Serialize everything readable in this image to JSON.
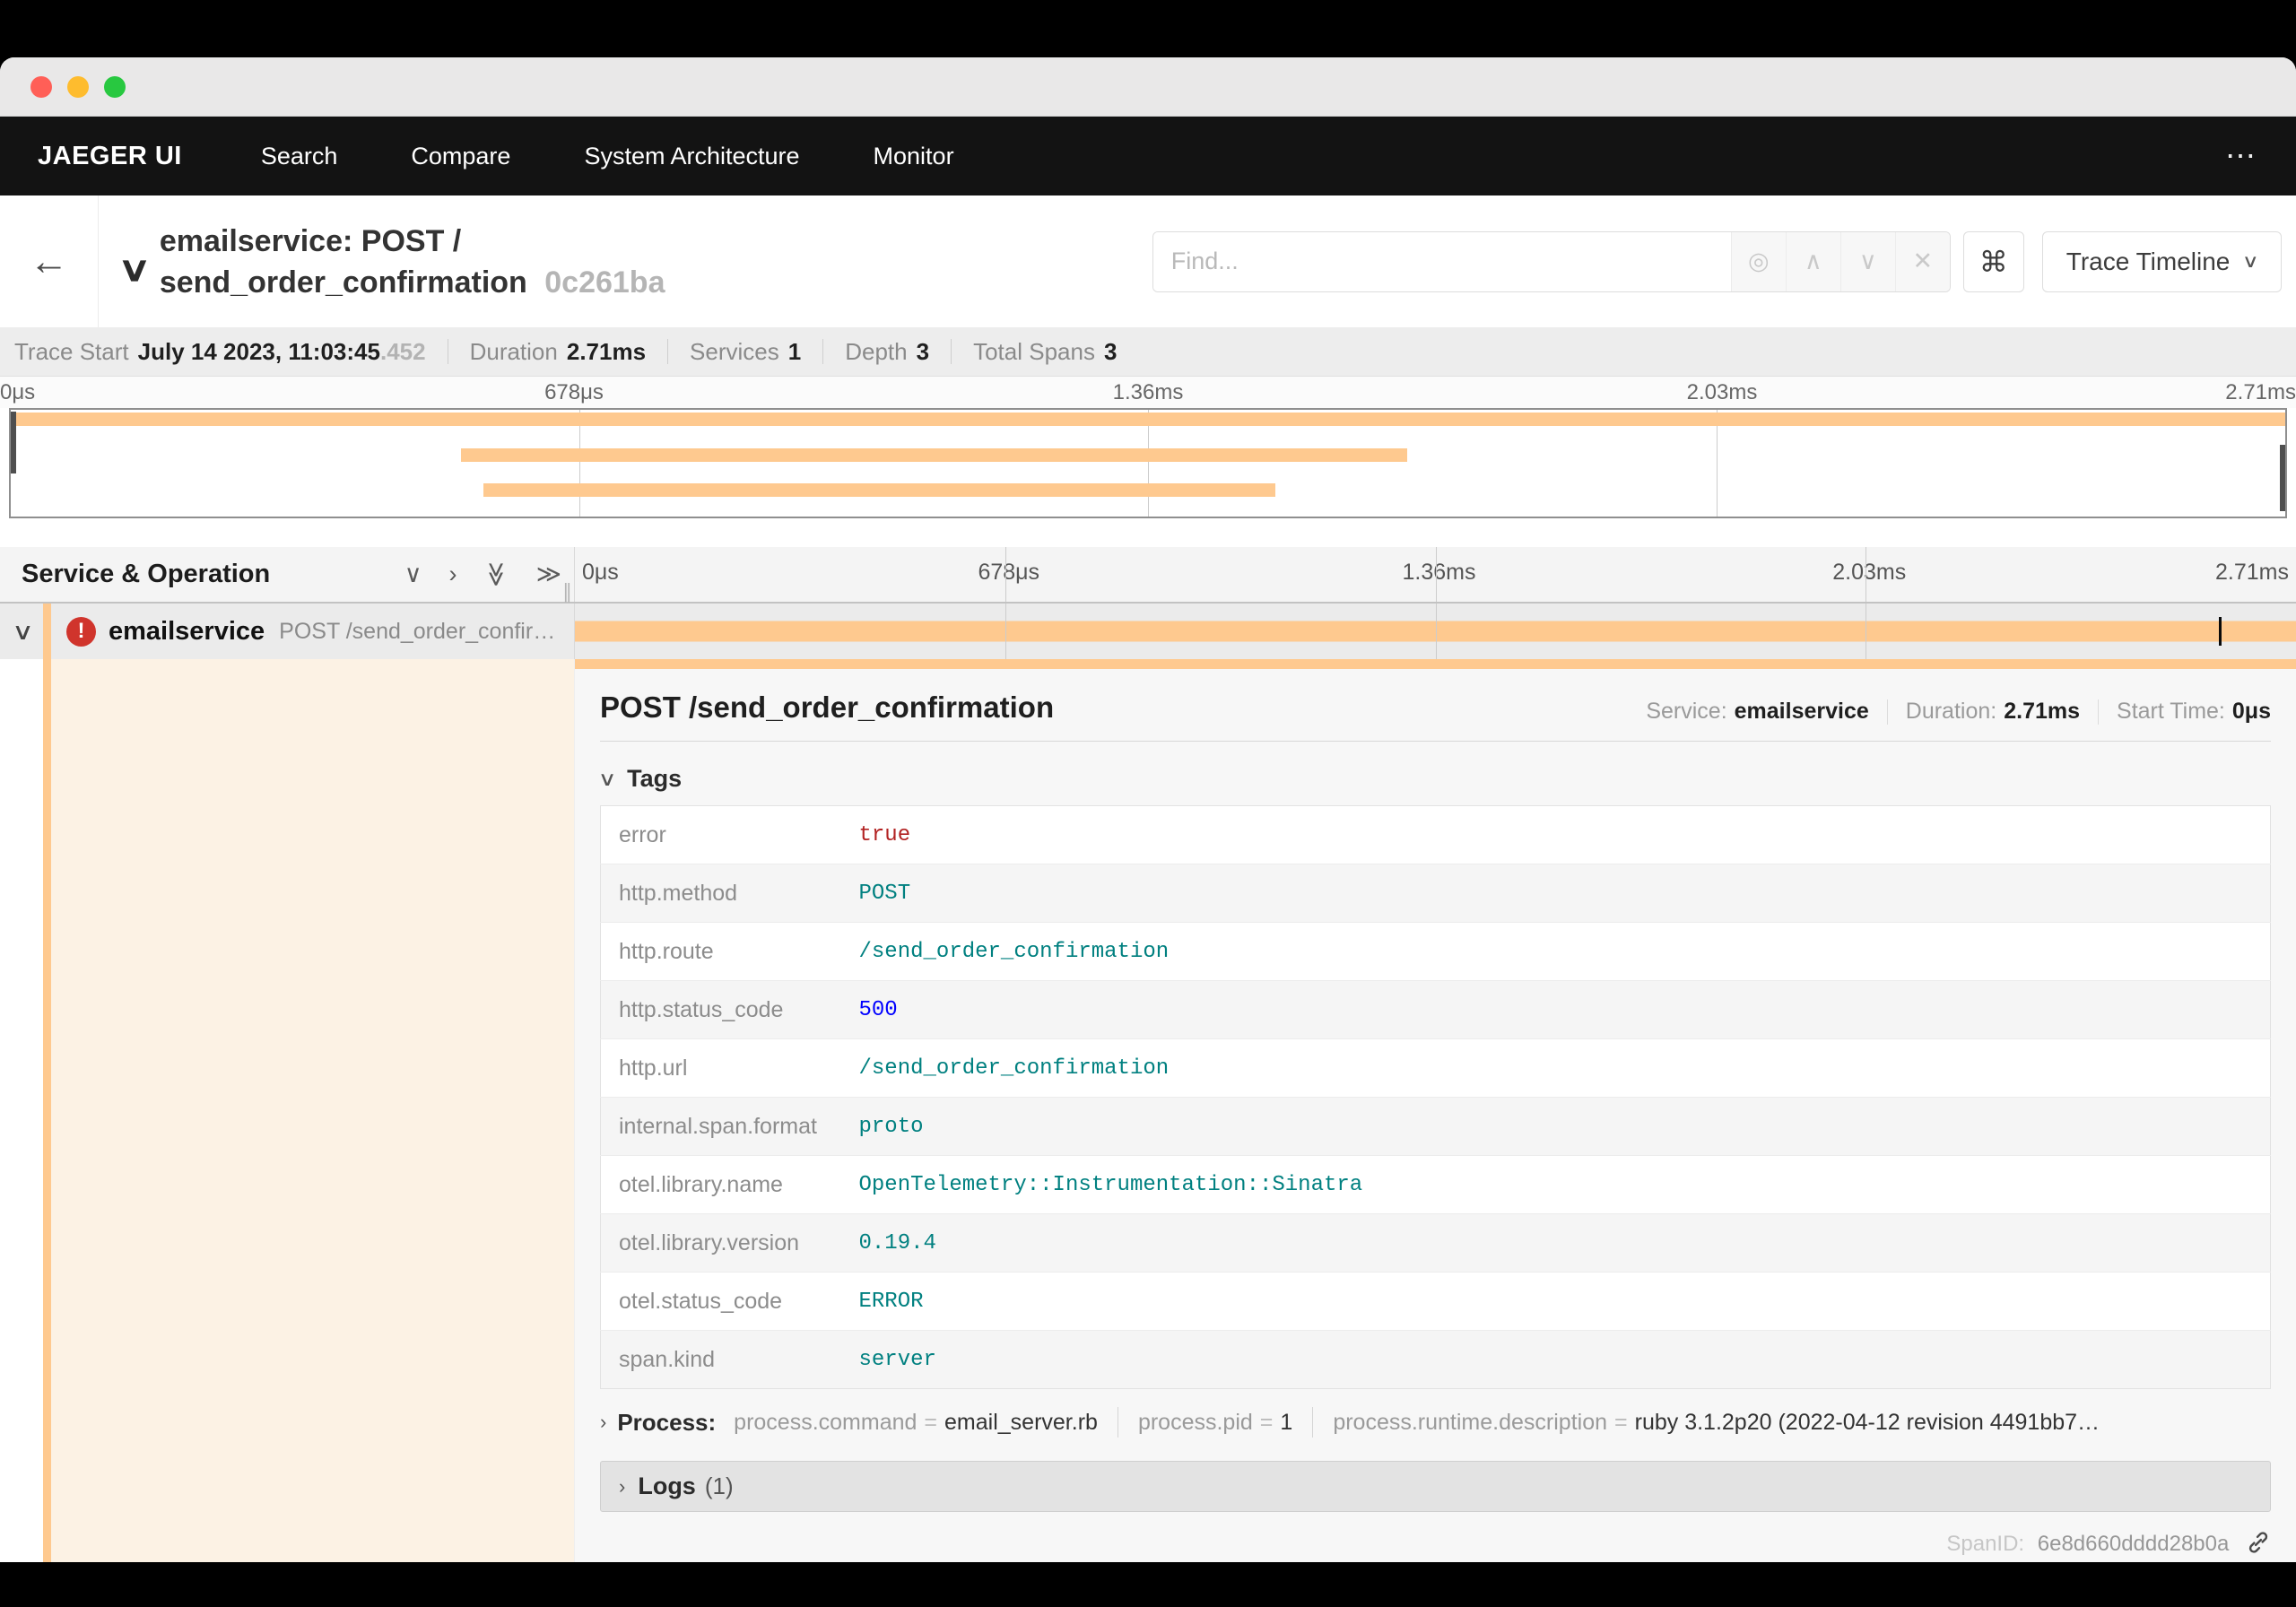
{
  "colors": {
    "accent_orange": "#FEC98F",
    "row_cream": "#FCF2E4",
    "error_red": "#D0342C",
    "value_string": "teal",
    "value_number": "blue",
    "value_bool": "firebrick"
  },
  "titlebar": {
    "lights": [
      "#ff5f57",
      "#febc2e",
      "#28c840"
    ]
  },
  "nav": {
    "brand": "JAEGER UI",
    "items": [
      "Search",
      "Compare",
      "System Architecture",
      "Monitor"
    ],
    "overflow_icon": "⋯"
  },
  "trace_header": {
    "back_icon": "←",
    "collapse_icon": "∨",
    "title_line1": "emailservice: POST /",
    "title_line2": "send_order_confirmation",
    "trace_id": "0c261ba",
    "find": {
      "placeholder": "Find...",
      "target_icon": "◎",
      "prev_icon": "∧",
      "next_icon": "∨",
      "clear_icon": "✕"
    },
    "shortcut_icon": "⌘",
    "view_dropdown": {
      "label": "Trace Timeline",
      "chevron_icon": "∨"
    }
  },
  "summary": {
    "items": [
      {
        "label": "Trace Start",
        "value": "July 14 2023, 11:03:45",
        "muted": ".452"
      },
      {
        "label": "Duration",
        "value": "2.71ms"
      },
      {
        "label": "Services",
        "value": "1"
      },
      {
        "label": "Depth",
        "value": "3"
      },
      {
        "label": "Total Spans",
        "value": "3"
      }
    ]
  },
  "ticks": [
    "0μs",
    "678μs",
    "1.36ms",
    "2.03ms",
    "2.71ms"
  ],
  "minimap": {
    "bars": [
      {
        "start": 0,
        "end": 100
      },
      {
        "start": 19.8,
        "end": 61.4
      },
      {
        "start": 20.8,
        "end": 55.6
      }
    ]
  },
  "grid_header": {
    "label": "Service & Operation",
    "collapse_one_icon": "∨",
    "expand_one_icon": "›",
    "collapse_all_icon": "≫",
    "expand_all_icon": "≫",
    "resizer_icon": "∥"
  },
  "span_row": {
    "expander_icon": "∨",
    "error_icon": "!",
    "service": "emailservice",
    "operation": "POST /send_order_confirmation",
    "bar": {
      "start": 0,
      "end": 100
    },
    "log_marker_pct": 95.5
  },
  "span_detail": {
    "title": "POST /send_order_confirmation",
    "stats": [
      {
        "label": "Service:",
        "value": "emailservice"
      },
      {
        "label": "Duration:",
        "value": "2.71ms"
      },
      {
        "label": "Start Time:",
        "value": "0μs"
      }
    ],
    "tags_section": {
      "chevron_icon": "∨",
      "label": "Tags"
    },
    "tags": [
      {
        "key": "error",
        "value": "true",
        "type": "bool"
      },
      {
        "key": "http.method",
        "value": "POST",
        "type": "string"
      },
      {
        "key": "http.route",
        "value": "/send_order_confirmation",
        "type": "string"
      },
      {
        "key": "http.status_code",
        "value": "500",
        "type": "number"
      },
      {
        "key": "http.url",
        "value": "/send_order_confirmation",
        "type": "string"
      },
      {
        "key": "internal.span.format",
        "value": "proto",
        "type": "string"
      },
      {
        "key": "otel.library.name",
        "value": "OpenTelemetry::Instrumentation::Sinatra",
        "type": "string"
      },
      {
        "key": "otel.library.version",
        "value": "0.19.4",
        "type": "string"
      },
      {
        "key": "otel.status_code",
        "value": "ERROR",
        "type": "string"
      },
      {
        "key": "span.kind",
        "value": "server",
        "type": "string"
      }
    ],
    "process_section": {
      "chevron_icon": "›",
      "label": "Process:",
      "items": [
        {
          "key": "process.command",
          "value": "email_server.rb"
        },
        {
          "key": "process.pid",
          "value": "1"
        },
        {
          "key": "process.runtime.description",
          "value": "ruby 3.1.2p20 (2022-04-12 revision 4491bb7…"
        }
      ]
    },
    "logs_section": {
      "chevron_icon": "›",
      "label": "Logs",
      "count": "(1)"
    },
    "footer": {
      "span_id_label": "SpanID:",
      "span_id": "6e8d660dddd28b0a",
      "link_icon": "link"
    }
  }
}
